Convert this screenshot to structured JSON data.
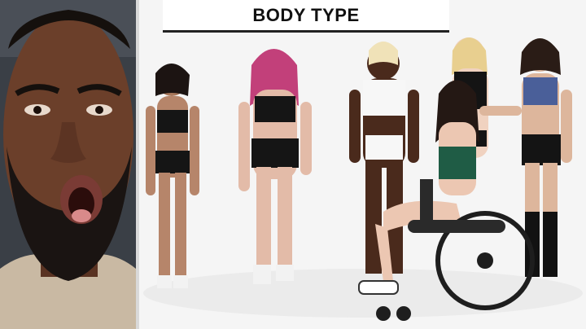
{
  "title": "BODY TYPE",
  "colors": {
    "reaction_bg": "#3a3f46",
    "skin_dark": "#6b3f2a",
    "beard": "#1a1412",
    "stage_bg": "#f5f5f5",
    "title_border": "#222222"
  }
}
